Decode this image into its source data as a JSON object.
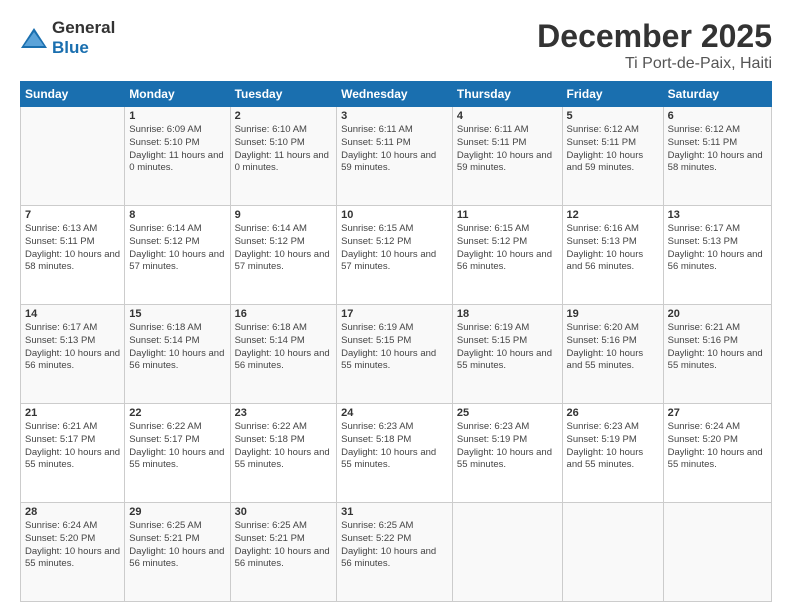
{
  "header": {
    "logo_general": "General",
    "logo_blue": "Blue",
    "title": "December 2025",
    "subtitle": "Ti Port-de-Paix, Haiti"
  },
  "columns": [
    "Sunday",
    "Monday",
    "Tuesday",
    "Wednesday",
    "Thursday",
    "Friday",
    "Saturday"
  ],
  "weeks": [
    [
      {
        "day": "",
        "sunrise": "",
        "sunset": "",
        "daylight": ""
      },
      {
        "day": "1",
        "sunrise": "Sunrise: 6:09 AM",
        "sunset": "Sunset: 5:10 PM",
        "daylight": "Daylight: 11 hours and 0 minutes."
      },
      {
        "day": "2",
        "sunrise": "Sunrise: 6:10 AM",
        "sunset": "Sunset: 5:10 PM",
        "daylight": "Daylight: 11 hours and 0 minutes."
      },
      {
        "day": "3",
        "sunrise": "Sunrise: 6:11 AM",
        "sunset": "Sunset: 5:11 PM",
        "daylight": "Daylight: 10 hours and 59 minutes."
      },
      {
        "day": "4",
        "sunrise": "Sunrise: 6:11 AM",
        "sunset": "Sunset: 5:11 PM",
        "daylight": "Daylight: 10 hours and 59 minutes."
      },
      {
        "day": "5",
        "sunrise": "Sunrise: 6:12 AM",
        "sunset": "Sunset: 5:11 PM",
        "daylight": "Daylight: 10 hours and 59 minutes."
      },
      {
        "day": "6",
        "sunrise": "Sunrise: 6:12 AM",
        "sunset": "Sunset: 5:11 PM",
        "daylight": "Daylight: 10 hours and 58 minutes."
      }
    ],
    [
      {
        "day": "7",
        "sunrise": "Sunrise: 6:13 AM",
        "sunset": "Sunset: 5:11 PM",
        "daylight": "Daylight: 10 hours and 58 minutes."
      },
      {
        "day": "8",
        "sunrise": "Sunrise: 6:14 AM",
        "sunset": "Sunset: 5:12 PM",
        "daylight": "Daylight: 10 hours and 57 minutes."
      },
      {
        "day": "9",
        "sunrise": "Sunrise: 6:14 AM",
        "sunset": "Sunset: 5:12 PM",
        "daylight": "Daylight: 10 hours and 57 minutes."
      },
      {
        "day": "10",
        "sunrise": "Sunrise: 6:15 AM",
        "sunset": "Sunset: 5:12 PM",
        "daylight": "Daylight: 10 hours and 57 minutes."
      },
      {
        "day": "11",
        "sunrise": "Sunrise: 6:15 AM",
        "sunset": "Sunset: 5:12 PM",
        "daylight": "Daylight: 10 hours and 56 minutes."
      },
      {
        "day": "12",
        "sunrise": "Sunrise: 6:16 AM",
        "sunset": "Sunset: 5:13 PM",
        "daylight": "Daylight: 10 hours and 56 minutes."
      },
      {
        "day": "13",
        "sunrise": "Sunrise: 6:17 AM",
        "sunset": "Sunset: 5:13 PM",
        "daylight": "Daylight: 10 hours and 56 minutes."
      }
    ],
    [
      {
        "day": "14",
        "sunrise": "Sunrise: 6:17 AM",
        "sunset": "Sunset: 5:13 PM",
        "daylight": "Daylight: 10 hours and 56 minutes."
      },
      {
        "day": "15",
        "sunrise": "Sunrise: 6:18 AM",
        "sunset": "Sunset: 5:14 PM",
        "daylight": "Daylight: 10 hours and 56 minutes."
      },
      {
        "day": "16",
        "sunrise": "Sunrise: 6:18 AM",
        "sunset": "Sunset: 5:14 PM",
        "daylight": "Daylight: 10 hours and 56 minutes."
      },
      {
        "day": "17",
        "sunrise": "Sunrise: 6:19 AM",
        "sunset": "Sunset: 5:15 PM",
        "daylight": "Daylight: 10 hours and 55 minutes."
      },
      {
        "day": "18",
        "sunrise": "Sunrise: 6:19 AM",
        "sunset": "Sunset: 5:15 PM",
        "daylight": "Daylight: 10 hours and 55 minutes."
      },
      {
        "day": "19",
        "sunrise": "Sunrise: 6:20 AM",
        "sunset": "Sunset: 5:16 PM",
        "daylight": "Daylight: 10 hours and 55 minutes."
      },
      {
        "day": "20",
        "sunrise": "Sunrise: 6:21 AM",
        "sunset": "Sunset: 5:16 PM",
        "daylight": "Daylight: 10 hours and 55 minutes."
      }
    ],
    [
      {
        "day": "21",
        "sunrise": "Sunrise: 6:21 AM",
        "sunset": "Sunset: 5:17 PM",
        "daylight": "Daylight: 10 hours and 55 minutes."
      },
      {
        "day": "22",
        "sunrise": "Sunrise: 6:22 AM",
        "sunset": "Sunset: 5:17 PM",
        "daylight": "Daylight: 10 hours and 55 minutes."
      },
      {
        "day": "23",
        "sunrise": "Sunrise: 6:22 AM",
        "sunset": "Sunset: 5:18 PM",
        "daylight": "Daylight: 10 hours and 55 minutes."
      },
      {
        "day": "24",
        "sunrise": "Sunrise: 6:23 AM",
        "sunset": "Sunset: 5:18 PM",
        "daylight": "Daylight: 10 hours and 55 minutes."
      },
      {
        "day": "25",
        "sunrise": "Sunrise: 6:23 AM",
        "sunset": "Sunset: 5:19 PM",
        "daylight": "Daylight: 10 hours and 55 minutes."
      },
      {
        "day": "26",
        "sunrise": "Sunrise: 6:23 AM",
        "sunset": "Sunset: 5:19 PM",
        "daylight": "Daylight: 10 hours and 55 minutes."
      },
      {
        "day": "27",
        "sunrise": "Sunrise: 6:24 AM",
        "sunset": "Sunset: 5:20 PM",
        "daylight": "Daylight: 10 hours and 55 minutes."
      }
    ],
    [
      {
        "day": "28",
        "sunrise": "Sunrise: 6:24 AM",
        "sunset": "Sunset: 5:20 PM",
        "daylight": "Daylight: 10 hours and 55 minutes."
      },
      {
        "day": "29",
        "sunrise": "Sunrise: 6:25 AM",
        "sunset": "Sunset: 5:21 PM",
        "daylight": "Daylight: 10 hours and 56 minutes."
      },
      {
        "day": "30",
        "sunrise": "Sunrise: 6:25 AM",
        "sunset": "Sunset: 5:21 PM",
        "daylight": "Daylight: 10 hours and 56 minutes."
      },
      {
        "day": "31",
        "sunrise": "Sunrise: 6:25 AM",
        "sunset": "Sunset: 5:22 PM",
        "daylight": "Daylight: 10 hours and 56 minutes."
      },
      {
        "day": "",
        "sunrise": "",
        "sunset": "",
        "daylight": ""
      },
      {
        "day": "",
        "sunrise": "",
        "sunset": "",
        "daylight": ""
      },
      {
        "day": "",
        "sunrise": "",
        "sunset": "",
        "daylight": ""
      }
    ]
  ]
}
